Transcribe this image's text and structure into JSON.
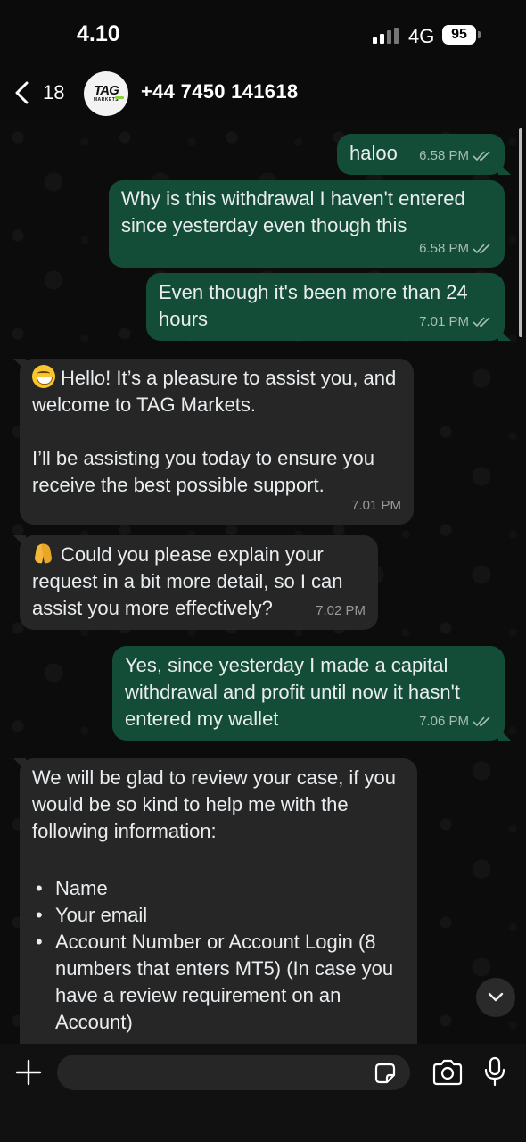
{
  "status_bar": {
    "time": "4.10",
    "network": "4G",
    "battery": "95"
  },
  "header": {
    "back_count": "18",
    "contact_name": "+44 7450 141618",
    "avatar_main": "TAG",
    "avatar_sub": "MARKETS"
  },
  "messages": [
    {
      "direction": "out",
      "text": "haloo",
      "time": "6.58 PM"
    },
    {
      "direction": "out",
      "text": "Why is this withdrawal I haven't entered since yesterday even though this",
      "time": "6.58 PM"
    },
    {
      "direction": "out",
      "text": "Even though it's been more than 24 hours",
      "time": "7.01 PM"
    },
    {
      "direction": "in",
      "emoji": "grinning-face",
      "text": "Hello! It’s a pleasure to assist you, and welcome to TAG Markets.\n\nI’ll be assisting you today to ensure you receive the best possible support.",
      "time": "7.01 PM"
    },
    {
      "direction": "in",
      "emoji": "folded-hands",
      "text": "Could you please explain your request in a bit more detail, so I can assist you more effectively?",
      "time": "7.02 PM"
    },
    {
      "direction": "out",
      "text": "Yes, since yesterday I made a capital withdrawal and profit until now it hasn't entered my wallet",
      "time": "7.06 PM"
    },
    {
      "direction": "in",
      "text": "We will be glad to review your case, if you would be so kind to help me with the following information:",
      "bullets": [
        "Name",
        "Your email",
        "Account Number or Account Login (8 numbers that enters MT5) (In case you have a review requirement on an Account)"
      ]
    }
  ],
  "input": {
    "placeholder": "",
    "value": ""
  },
  "icons": {
    "back": "chevron-left-icon",
    "ticks": "double-check-icon",
    "scroll_down": "chevron-down-icon",
    "plus": "plus-icon",
    "sticker": "sticker-icon",
    "camera": "camera-icon",
    "mic": "microphone-icon"
  },
  "colors": {
    "outgoing_bubble": "#144d37",
    "incoming_bubble": "#262626",
    "background": "#0b0b0b"
  }
}
